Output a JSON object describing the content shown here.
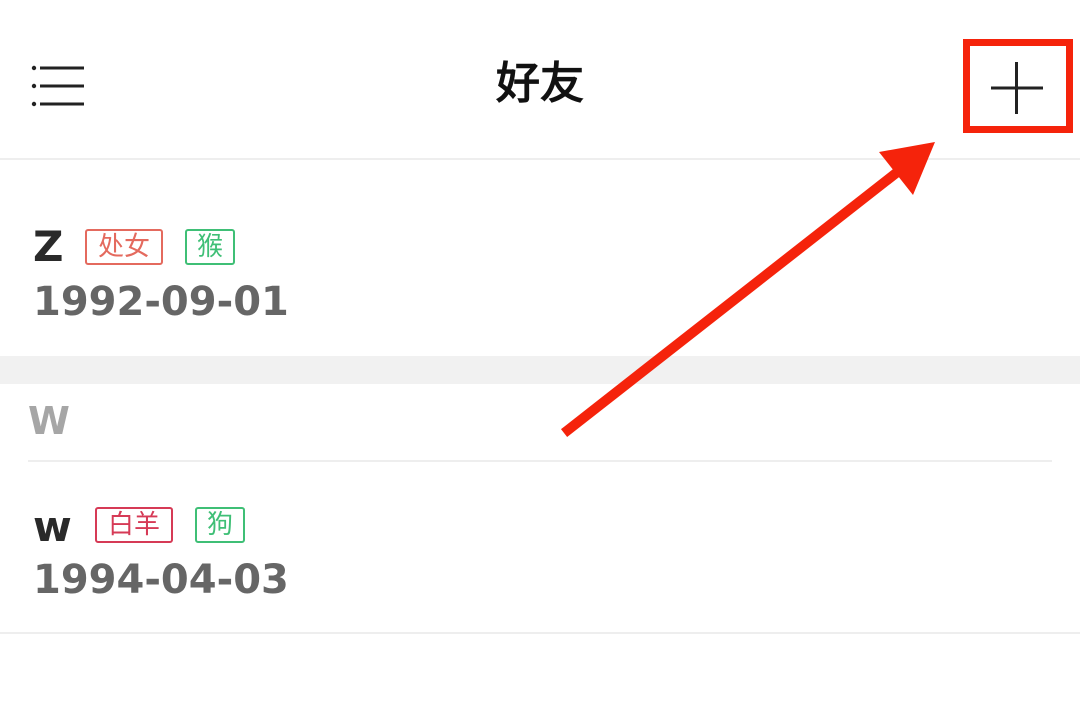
{
  "header": {
    "menu_icon": "menu-icon",
    "title": "好友",
    "add_icon": "plus-icon"
  },
  "friends_top": {
    "name": "Z",
    "zodiac_tag": "处女",
    "animal_tag": "猴",
    "birthday": "1992-09-01"
  },
  "section": {
    "letter": "W"
  },
  "friends_w": {
    "name": "w",
    "zodiac_tag": "白羊",
    "animal_tag": "狗",
    "birthday": "1994-04-03"
  },
  "colors": {
    "highlight": "#f5230b",
    "tag_virgo": "#e46a5e",
    "tag_aries": "#d63a56",
    "tag_animal": "#3fbf76"
  }
}
